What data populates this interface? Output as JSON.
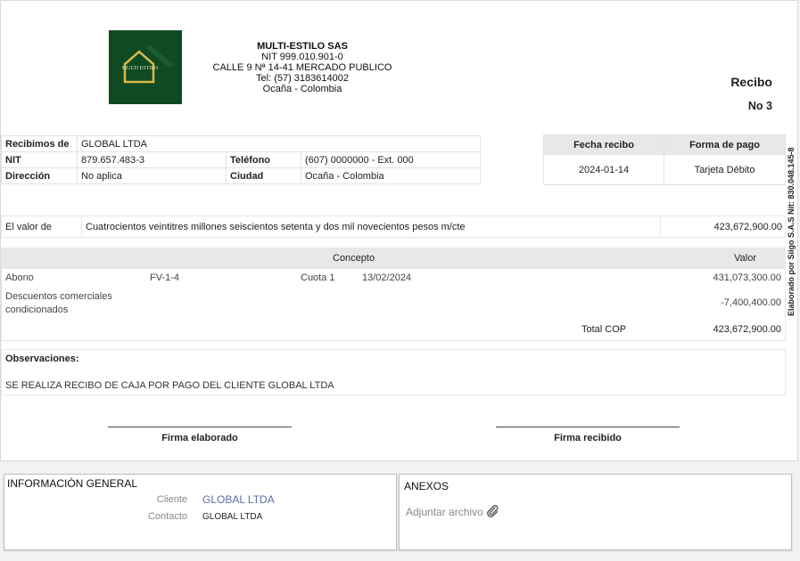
{
  "company": {
    "logo_text": "MULTI ESTILO",
    "name": "MULTI-ESTILO SAS",
    "nit": "NIT 999.010.901-0",
    "address": "CALLE 9 Nª 14-41 MERCADO PUBLICO",
    "phone": "Tel: (57) 3183614002",
    "city": "Ocaña - Colombia"
  },
  "document": {
    "title": "Recibo",
    "number": "No 3"
  },
  "info": {
    "received_label": "Recibimos de",
    "received_value": "GLOBAL LTDA",
    "nit_label": "NIT",
    "nit_value": "879.657.483-3",
    "phone_label": "Teléfono",
    "phone_value": "(607) 0000000 - Ext. 000",
    "address_label": "Dirección",
    "address_value": "No aplica",
    "city_label": "Ciudad",
    "city_value": "Ocaña - Colombia"
  },
  "payment": {
    "date_label": "Fecha recibo",
    "method_label": "Forma de pago",
    "date_value": "2024-01-14",
    "method_value": "Tarjeta Débito"
  },
  "side_text": "Elaborado por Siigo S.A.S Nit: 830.048.145-8",
  "value": {
    "label": "El valor de",
    "words": "Cuatrocientos veintitres millones seiscientos setenta y dos mil novecientos pesos m/cte",
    "amount": "423,672,900.00"
  },
  "concepts": {
    "header_concept": "Concepto",
    "header_value": "Valor",
    "rows": [
      {
        "concept": "Abono",
        "doc": "FV-1-4",
        "installment": "Cuota 1",
        "date": "13/02/2024",
        "value": "431,073,300.00"
      },
      {
        "concept": "Descuentos comerciales",
        "concept2": "condicionados",
        "value": "-7,400,400.00"
      }
    ],
    "total_label": "Total COP",
    "total_value": "423,672,900.00"
  },
  "observations": {
    "label": "Observaciones:",
    "text": "SE REALIZA RECIBO DE CAJA POR PAGO DEL CLIENTE GLOBAL LTDA"
  },
  "signatures": {
    "left_line": "____________________________________",
    "left": "Firma elaborado",
    "right_line": "____________________________________",
    "right": "Firma recibido"
  },
  "general_info": {
    "title": "INFORMACIÓN GENERAL",
    "client_label": "Cliente",
    "client_value": "GLOBAL LTDA",
    "contact_label": "Contacto",
    "contact_value": "GLOBAL LTDA"
  },
  "annexes": {
    "title": "ANEXOS",
    "attach_label": "Adjuntar archivo",
    "attach_icon": "paperclip-icon"
  }
}
